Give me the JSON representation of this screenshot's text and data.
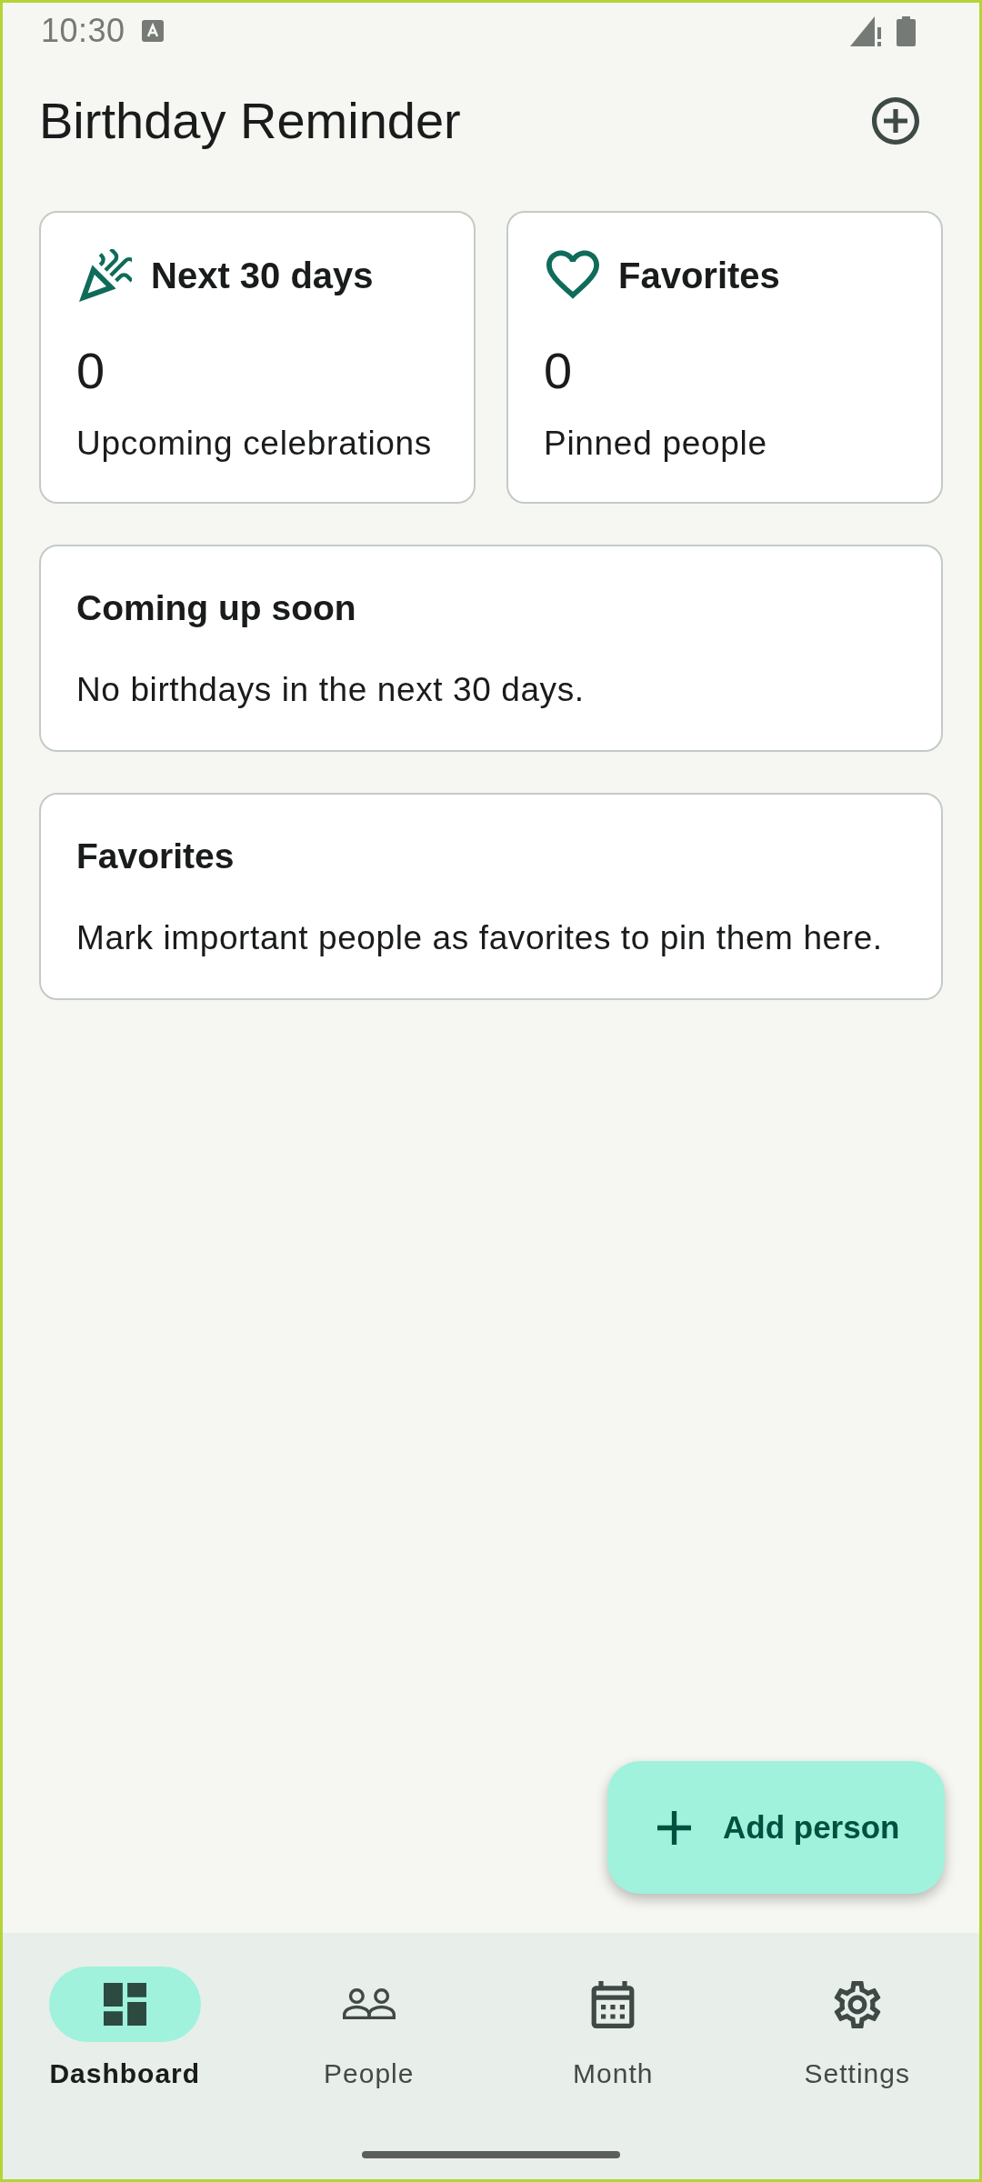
{
  "status_bar": {
    "time": "10:30"
  },
  "app_bar": {
    "title": "Birthday Reminder"
  },
  "stat_cards": [
    {
      "kind": "celebrations",
      "title": "Next 30 days",
      "value": "0",
      "caption": "Upcoming celebrations"
    },
    {
      "kind": "favorites",
      "title": "Favorites",
      "value": "0",
      "caption": "Pinned people"
    }
  ],
  "sections": [
    {
      "title": "Coming up soon",
      "message": "No birthdays in the next 30 days."
    },
    {
      "title": "Favorites",
      "message": "Mark important people as favorites to pin them here."
    }
  ],
  "fab": {
    "label": "Add person"
  },
  "bottom_nav": {
    "items": [
      {
        "kind": "dashboard",
        "label": "Dashboard",
        "selected": true
      },
      {
        "kind": "people",
        "label": "People",
        "selected": false
      },
      {
        "kind": "month",
        "label": "Month",
        "selected": false
      },
      {
        "kind": "settings",
        "label": "Settings",
        "selected": false
      }
    ]
  }
}
